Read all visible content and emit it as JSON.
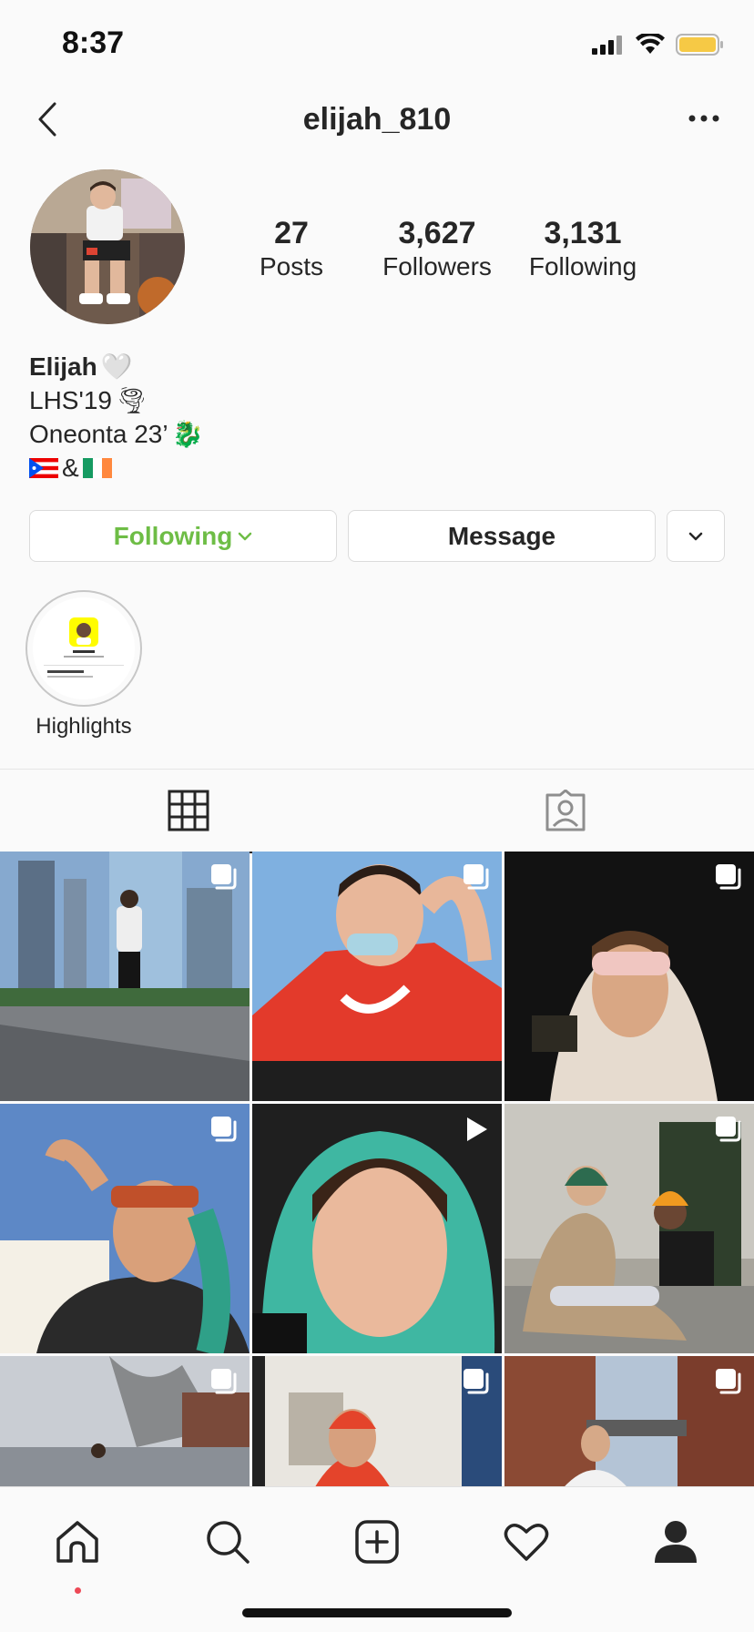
{
  "status_bar": {
    "time": "8:37",
    "icons": [
      "cellular-signal-icon",
      "wifi-icon",
      "battery-icon"
    ],
    "battery_color": "#f6c945"
  },
  "nav": {
    "username": "elijah_810",
    "back_icon": "chevron-left-icon",
    "more_icon": "ellipsis-icon"
  },
  "profile": {
    "stats": [
      {
        "value": "27",
        "label": "Posts"
      },
      {
        "value": "3,627",
        "label": "Followers"
      },
      {
        "value": "3,131",
        "label": "Following"
      }
    ],
    "bio": {
      "name": "Elijah",
      "name_emoji": "🤍",
      "line1": "LHS'19",
      "line1_emoji": "🌪",
      "line2": "Oneonta 23’",
      "line2_emoji": "🐉",
      "line3_amp": "&"
    }
  },
  "actions": {
    "following_label": "Following",
    "message_label": "Message",
    "following_color": "#6ebd46"
  },
  "highlights": [
    {
      "label": "Highlights"
    }
  ],
  "tabs": [
    {
      "name": "grid-tab",
      "icon": "grid-icon",
      "active": true
    },
    {
      "name": "tagged-tab",
      "icon": "tagged-person-icon",
      "active": false
    }
  ],
  "posts": [
    {
      "type": "carousel"
    },
    {
      "type": "carousel"
    },
    {
      "type": "carousel"
    },
    {
      "type": "carousel"
    },
    {
      "type": "video"
    },
    {
      "type": "carousel"
    },
    {
      "type": "carousel"
    },
    {
      "type": "carousel"
    },
    {
      "type": "carousel"
    }
  ],
  "bottom_nav": [
    {
      "icon": "home-icon"
    },
    {
      "icon": "search-icon"
    },
    {
      "icon": "new-post-icon"
    },
    {
      "icon": "heart-icon"
    },
    {
      "icon": "profile-icon"
    }
  ]
}
